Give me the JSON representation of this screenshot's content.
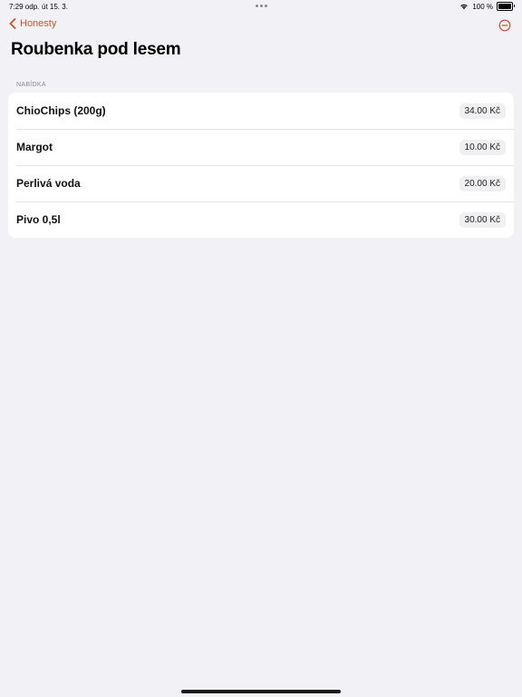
{
  "status_bar": {
    "time": "7:29 odp.",
    "date": "út 15. 3.",
    "battery": "100 %",
    "wifi_icon": "wifi-icon",
    "battery_icon": "battery-icon"
  },
  "nav": {
    "back_label": "Honesty",
    "back_icon": "chevron-left-icon",
    "action_icon": "minus-circle-icon",
    "accent_color": "#c8542c"
  },
  "title": "Roubenka pod lesem",
  "section": {
    "header": "NABÍDKA"
  },
  "items": [
    {
      "name": "ChioChips (200g)",
      "price": "34.00 Kč"
    },
    {
      "name": "Margot",
      "price": "10.00 Kč"
    },
    {
      "name": "Perlivá voda",
      "price": "20.00 Kč"
    },
    {
      "name": "Pivo 0,5l",
      "price": "30.00 Kč"
    }
  ]
}
